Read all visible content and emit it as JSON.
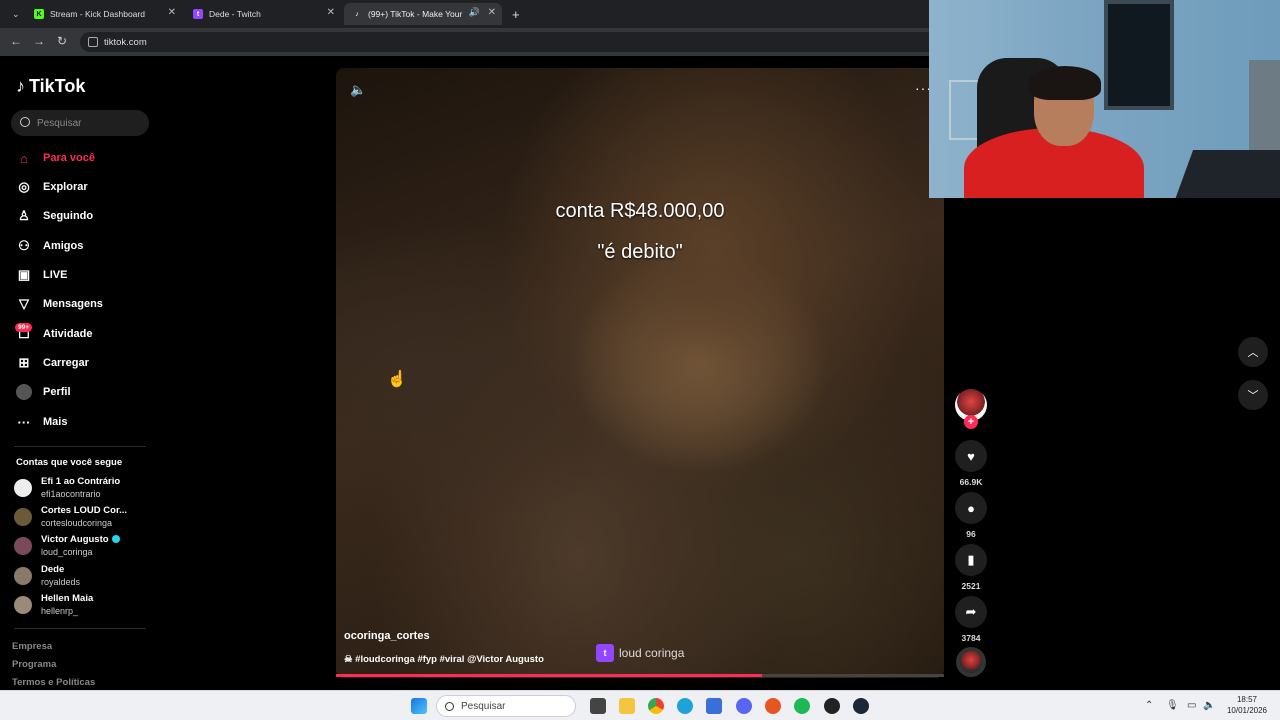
{
  "browser": {
    "tabs": [
      {
        "label": "Stream - Kick Dashboard",
        "favicon": "kick-icon",
        "favicon_color": "#53fc18"
      },
      {
        "label": "Dede - Twitch",
        "favicon": "twitch-icon",
        "favicon_color": "#9146ff"
      },
      {
        "label": "(99+) TikTok - Make Your Da",
        "favicon": "tiktok-icon",
        "favicon_color": "#ffffff",
        "active": true
      }
    ],
    "new_tab": "+",
    "url": "tiktok.com"
  },
  "sidebar": {
    "brand": "TikTok",
    "search_placeholder": "Pesquisar",
    "nav": [
      {
        "label": "Para você",
        "icon": "home-icon",
        "active": true
      },
      {
        "label": "Explorar",
        "icon": "compass-icon"
      },
      {
        "label": "Seguindo",
        "icon": "following-icon"
      },
      {
        "label": "Amigos",
        "icon": "friends-icon"
      },
      {
        "label": "LIVE",
        "icon": "live-icon"
      },
      {
        "label": "Mensagens",
        "icon": "messages-icon"
      },
      {
        "label": "Atividade",
        "icon": "activity-icon"
      },
      {
        "label": "Carregar",
        "icon": "upload-icon"
      },
      {
        "label": "Perfil",
        "icon": "profile-icon"
      },
      {
        "label": "Mais",
        "icon": "more-icon"
      }
    ],
    "activity_badge": "99+",
    "following_title": "Contas que você segue",
    "following": [
      {
        "name": "Efi 1 ao Contrário",
        "handle": "efi1aocontrario"
      },
      {
        "name": "Cortes LOUD Cor...",
        "handle": "cortesloudcoringa"
      },
      {
        "name": "Victor Augusto",
        "handle": "loud_coringa",
        "verified": true
      },
      {
        "name": "Dede",
        "handle": "royaldeds"
      },
      {
        "name": "Hellen Maia",
        "handle": "hellenrp_"
      }
    ],
    "footer": [
      "Empresa",
      "Programa",
      "Termos e Políticas"
    ]
  },
  "video": {
    "overlay_line1": "conta R$48.000,00",
    "overlay_line2": "\"é debito\"",
    "author": "ocoringa_cortes",
    "caption": "☠ #loudcoringa #fyp #viral @Victor Augusto",
    "watermark": "loud coringa",
    "progress": 0.7
  },
  "actions": {
    "likes": "66.9K",
    "comments": "96",
    "saves": "2521",
    "shares": "3784"
  },
  "taskbar": {
    "search_placeholder": "Pesquisar",
    "time": "18:57",
    "date": "10/01/2026"
  },
  "colors": {
    "accent": "#fe2c55",
    "twitch": "#9146ff"
  }
}
